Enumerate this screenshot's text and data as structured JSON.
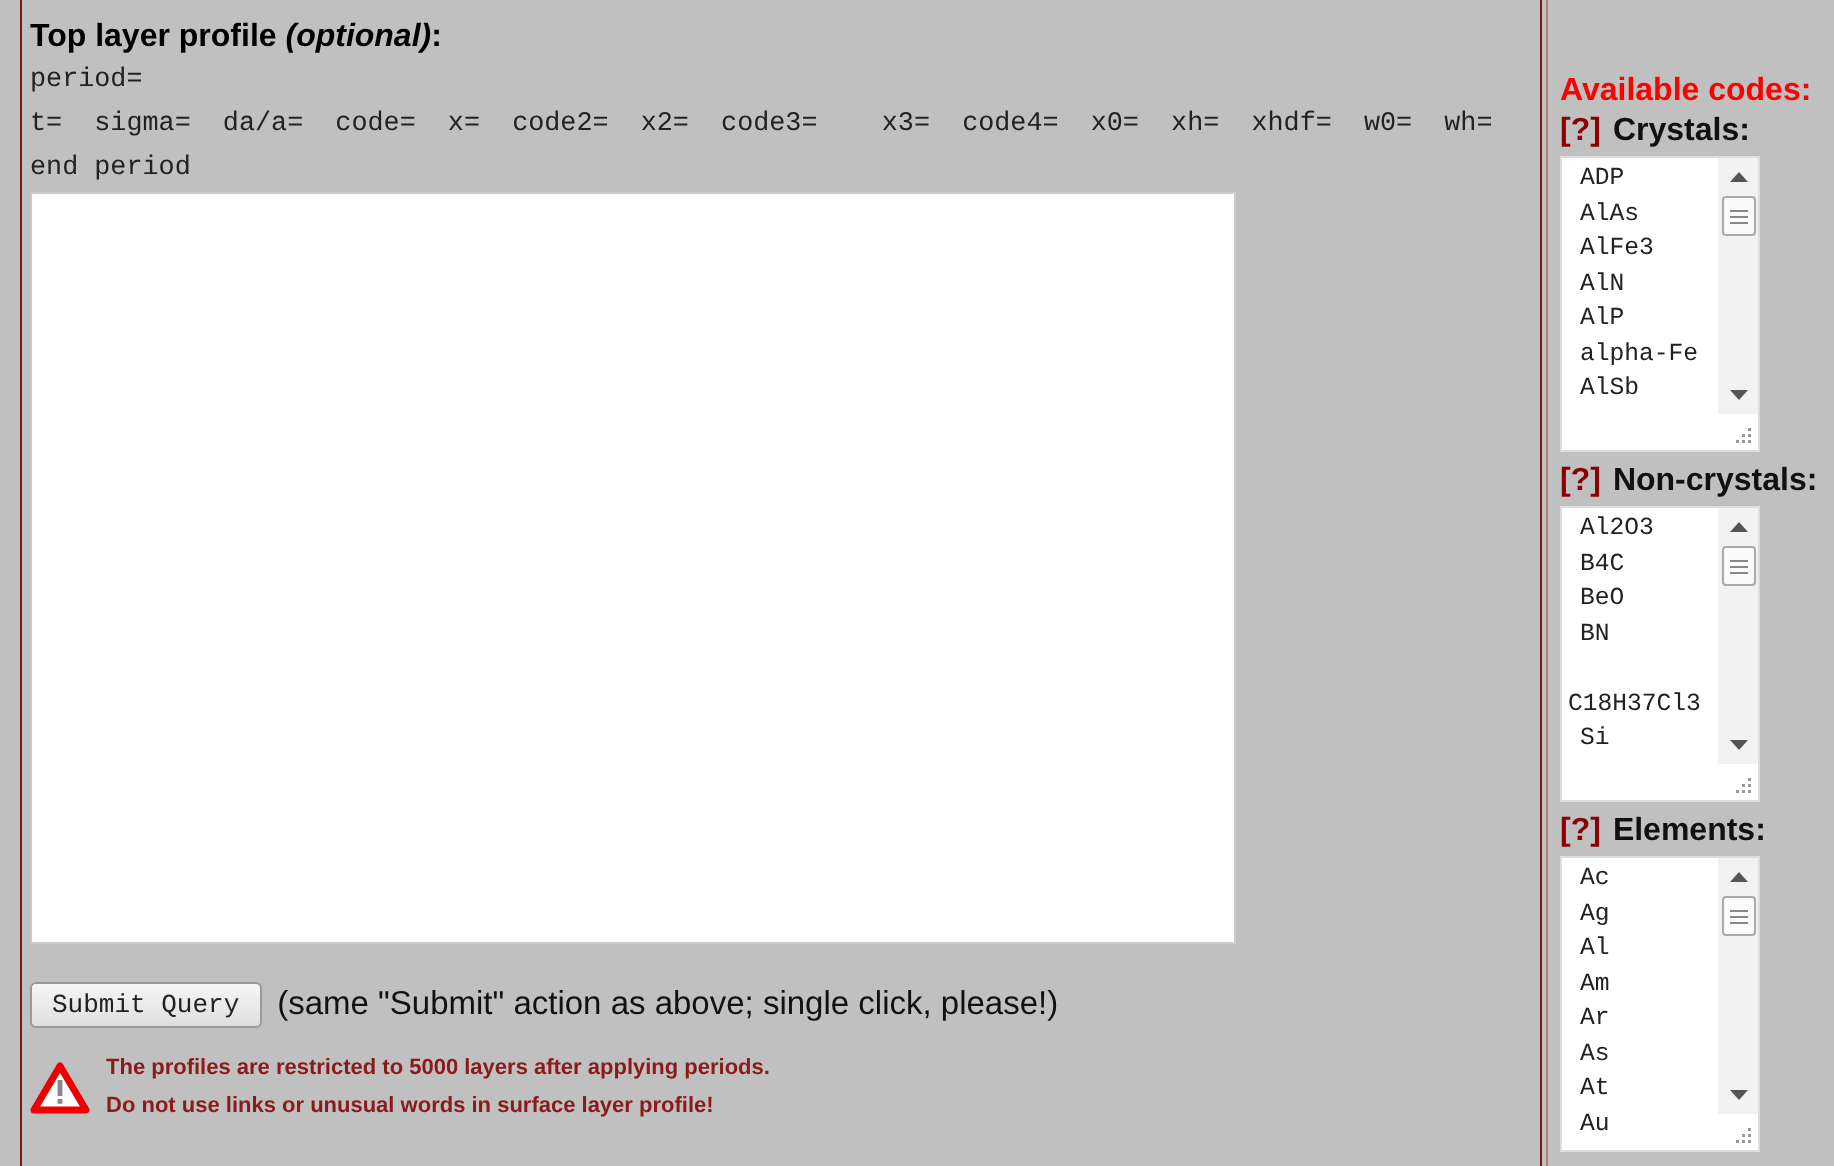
{
  "profile": {
    "title": "Top layer profile ",
    "title_note": "(optional)",
    "title_end": ":",
    "template_lines": [
      "period=",
      "t=  sigma=  da/a=  code=  x=  code2=  x2=  code3=    x3=  code4=  x0=  xh=  xhdf=  w0=  wh=",
      "end period"
    ],
    "submit": {
      "label": "Submit Query",
      "note": "(same \"Submit\" action as above; single click, please!)"
    },
    "warnings": [
      "The profiles are restricted to 5000 layers after applying periods.",
      "Do not use links or unusual words in surface layer profile!"
    ]
  },
  "codes": {
    "title": "Available codes:",
    "groups": [
      {
        "help": "[?]",
        "label": "Crystals:",
        "items": [
          {
            "text": "ADP"
          },
          {
            "text": "AlAs"
          },
          {
            "text": "AlFe3"
          },
          {
            "text": "AlN"
          },
          {
            "text": "AlP"
          },
          {
            "text": "alpha-Fe"
          },
          {
            "text": "AlSb"
          }
        ]
      },
      {
        "help": "[?]",
        "label": "Non-crystals:",
        "items": [
          {
            "text": "Al2O3"
          },
          {
            "text": "B4C"
          },
          {
            "text": "BeO"
          },
          {
            "text": "BN"
          },
          {
            "text": "C18H37Cl3",
            "gap_before": true
          },
          {
            "text": "Si"
          }
        ]
      },
      {
        "help": "[?]",
        "label": "Elements:",
        "items": [
          {
            "text": "Ac"
          },
          {
            "text": "Ag"
          },
          {
            "text": "Al"
          },
          {
            "text": "Am"
          },
          {
            "text": "Ar"
          },
          {
            "text": "As"
          },
          {
            "text": "At"
          },
          {
            "text": "Au"
          }
        ]
      }
    ]
  }
}
